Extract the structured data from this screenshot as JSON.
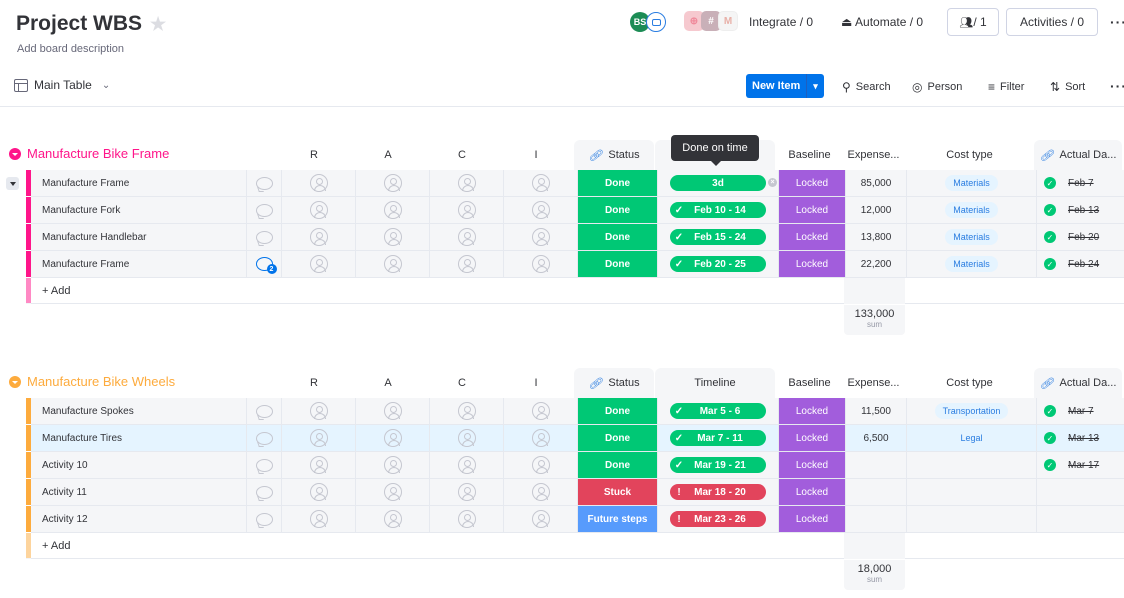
{
  "header": {
    "title": "Project WBS",
    "description": "Add board description",
    "view": "Main Table",
    "avatar_initials": "BS",
    "integrate": "Integrate / 0",
    "automate": "Automate / 0",
    "members": "/ 1",
    "activities": "Activities / 0"
  },
  "toolbar": {
    "new_item": "New Item",
    "search": "Search",
    "person": "Person",
    "filter": "Filter",
    "sort": "Sort"
  },
  "columns": {
    "r": "R",
    "a": "A",
    "c": "C",
    "i": "I",
    "status": "Status",
    "timeline": "Timeline",
    "baseline": "Baseline",
    "expenses": "Expense...",
    "cost_type": "Cost type",
    "actual": "Actual Da..."
  },
  "tooltip": "Done on time",
  "colors": {
    "done": "#00c875",
    "stuck": "#e2445c",
    "future": "#579bfc",
    "baseline": "#a25ddc",
    "group1": "#ff158a",
    "group2": "#fdab3d"
  },
  "groups": [
    {
      "title": "Manufacture Bike Frame",
      "color": "#ff158a",
      "add_label": "+ Add",
      "sum": "133,000",
      "sum_label": "sum",
      "rows": [
        {
          "name": "Manufacture Frame",
          "comments": "",
          "status": "Done",
          "timeline": "3d",
          "timeline_state": "done",
          "baseline": "Locked",
          "expense": "85,000",
          "cost_type": "Materials",
          "actual": "Feb 7"
        },
        {
          "name": "Manufacture Fork",
          "comments": "",
          "status": "Done",
          "timeline": "Feb 10 - 14",
          "timeline_state": "done",
          "baseline": "Locked",
          "expense": "12,000",
          "cost_type": "Materials",
          "actual": "Feb 13"
        },
        {
          "name": "Manufacture Handlebar",
          "comments": "",
          "status": "Done",
          "timeline": "Feb 15 - 24",
          "timeline_state": "done",
          "baseline": "Locked",
          "expense": "13,800",
          "cost_type": "Materials",
          "actual": "Feb 20"
        },
        {
          "name": "Manufacture Frame",
          "comments": "2",
          "status": "Done",
          "timeline": "Feb 20 - 25",
          "timeline_state": "done",
          "baseline": "Locked",
          "expense": "22,200",
          "cost_type": "Materials",
          "actual": "Feb 24"
        }
      ]
    },
    {
      "title": "Manufacture Bike Wheels",
      "color": "#fdab3d",
      "add_label": "+ Add",
      "sum": "18,000",
      "sum_label": "sum",
      "rows": [
        {
          "name": "Manufacture Spokes",
          "comments": "",
          "status": "Done",
          "timeline": "Mar 5 - 6",
          "timeline_state": "done",
          "baseline": "Locked",
          "expense": "11,500",
          "cost_type": "Transportation",
          "actual": "Mar 7"
        },
        {
          "name": "Manufacture Tires",
          "comments": "",
          "status": "Done",
          "timeline": "Mar 7 - 11",
          "timeline_state": "done",
          "baseline": "Locked",
          "expense": "6,500",
          "cost_type": "Legal",
          "actual": "Mar 13"
        },
        {
          "name": "Activity 10",
          "comments": "",
          "status": "Done",
          "timeline": "Mar 19 - 21",
          "timeline_state": "done",
          "baseline": "Locked",
          "expense": "",
          "cost_type": "",
          "actual": "Mar 17"
        },
        {
          "name": "Activity 11",
          "comments": "",
          "status": "Stuck",
          "timeline": "Mar 18 - 20",
          "timeline_state": "overdue",
          "baseline": "Locked",
          "expense": "",
          "cost_type": "",
          "actual": ""
        },
        {
          "name": "Activity 12",
          "comments": "",
          "status": "Future steps",
          "timeline": "Mar 23 - 26",
          "timeline_state": "overdue",
          "baseline": "Locked",
          "expense": "",
          "cost_type": "",
          "actual": ""
        }
      ]
    }
  ]
}
